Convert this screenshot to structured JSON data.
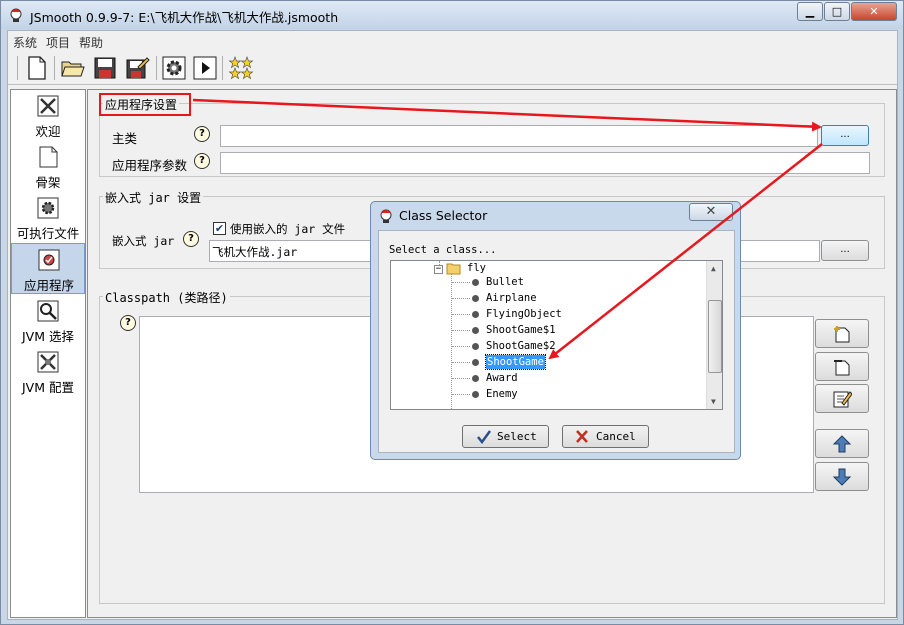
{
  "window": {
    "title": "JSmooth 0.9.9-7: E:\\飞机大作战\\飞机大作战.jsmooth",
    "minimize_label": "▁",
    "maximize_label": "□",
    "close_label": "✕"
  },
  "menu": [
    {
      "label": "系统"
    },
    {
      "label": "项目"
    },
    {
      "label": "帮助"
    }
  ],
  "toolbar": {
    "icons": [
      "new-file-icon",
      "open-folder-icon",
      "save-icon",
      "save-as-icon",
      "compile-gear-icon",
      "run-icon",
      "stars-icon"
    ]
  },
  "nav": {
    "items": [
      {
        "label": "欢迎",
        "icon": "welcome-tools-icon"
      },
      {
        "label": "骨架",
        "icon": "skeleton-page-icon"
      },
      {
        "label": "可执行文件",
        "icon": "executable-gear-icon"
      },
      {
        "label": "应用程序",
        "icon": "application-icon",
        "active": true
      },
      {
        "label": "JVM 选择",
        "icon": "jvm-search-icon"
      },
      {
        "label": "JVM 配置",
        "icon": "jvm-config-tools-icon"
      }
    ]
  },
  "app_settings": {
    "group_label": "应用程序设置",
    "main_class_label": "主类",
    "main_class_value": "",
    "args_label": "应用程序参数",
    "args_value": "",
    "browse_label": "..."
  },
  "embedded_jar": {
    "group_label": "嵌入式 jar 设置",
    "jar_label": "嵌入式 jar",
    "use_embedded_label": "使用嵌入的 jar 文件",
    "use_embedded_checked": true,
    "jar_value": "飞机大作战.jar",
    "browse_label": "..."
  },
  "classpath": {
    "group_label": "Classpath (类路径)",
    "buttons": [
      "add-classpath-icon",
      "add-file-icon",
      "edit-icon",
      "move-up-icon",
      "move-down-icon"
    ]
  },
  "class_selector": {
    "title": "Class Selector",
    "close_label": "✕",
    "prompt": "Select a class...",
    "package": "fly",
    "classes": [
      "Bullet",
      "Airplane",
      "FlyingObject",
      "ShootGame$1",
      "ShootGame$2",
      "ShootGame",
      "Award",
      "Enemy"
    ],
    "selected": "ShootGame",
    "select_label": "Select",
    "cancel_label": "Cancel"
  },
  "colors": {
    "annotation_red": "#e8171d",
    "selection_blue": "#3399ff"
  }
}
